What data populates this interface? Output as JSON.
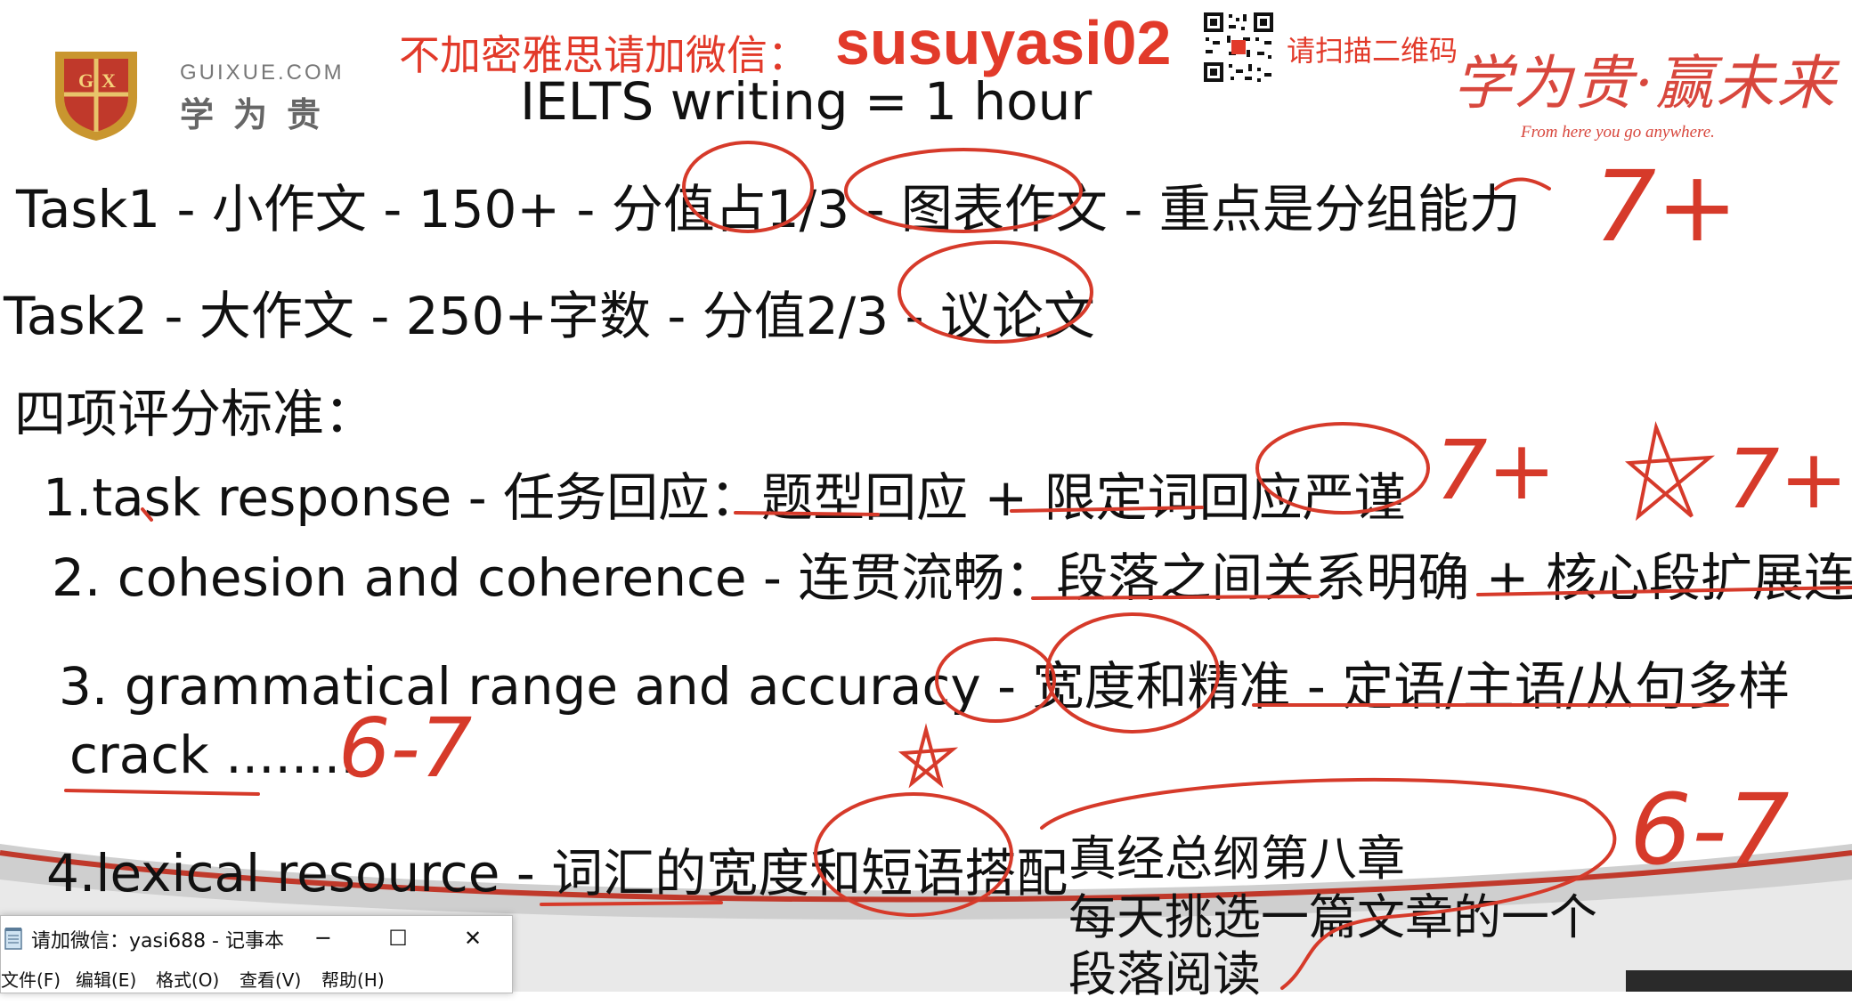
{
  "header": {
    "logo_domain": "GUIXUE.COM",
    "logo_cn": "学为贵",
    "watermark_left": "不加密雅思请加微信：",
    "watermark_id": "susuyasi02",
    "watermark_scan": "请扫描二维码",
    "slogan": "学为贵·赢未来",
    "slogan_sub": "From here you go anywhere."
  },
  "slide": {
    "title": "IELTS writing = 1 hour",
    "task1": "Task1 - 小作文 - 150+ - 分值占1/3 - 图表作文 - 重点是分组能力",
    "task2": "Task2 - 大作文 - 250+字数 - 分值2/3 - 议论文",
    "criteria_heading": "四项评分标准：",
    "criterion_1": "1.task response - 任务回应：题型回应 + 限定词回应严谨",
    "criterion_2": "2. cohesion and coherence - 连贯流畅：段落之间关系明确 + 核心段扩展连贯",
    "criterion_3": "3. grammatical range and accuracy - 宽度和精准 - 定语/主语/从句多样",
    "crack": "crack ........",
    "criterion_4": "4.lexical resource - 词汇的宽度和短语搭配",
    "note_line_1": "真经总纲第八章",
    "note_line_2": "每天挑选一篇文章的一个",
    "note_line_3": "段落阅读"
  },
  "handwriting": {
    "mark_task1": "7+",
    "mark_c1_a": "7+",
    "mark_c1_b": "7+",
    "mark_crack": "6-7",
    "mark_c4": "6-7"
  },
  "notepad": {
    "title": "请加微信：yasi688 - 记事本",
    "menus": [
      "文件(F)",
      "编辑(E)",
      "格式(O)",
      "查看(V)",
      "帮助(H)"
    ],
    "minimize_glyph": "─",
    "maximize_glyph": "☐",
    "close_glyph": "✕"
  },
  "colors": {
    "ink_red": "#d63a2a",
    "watermark_red": "#e23a2a",
    "text": "#111111"
  }
}
